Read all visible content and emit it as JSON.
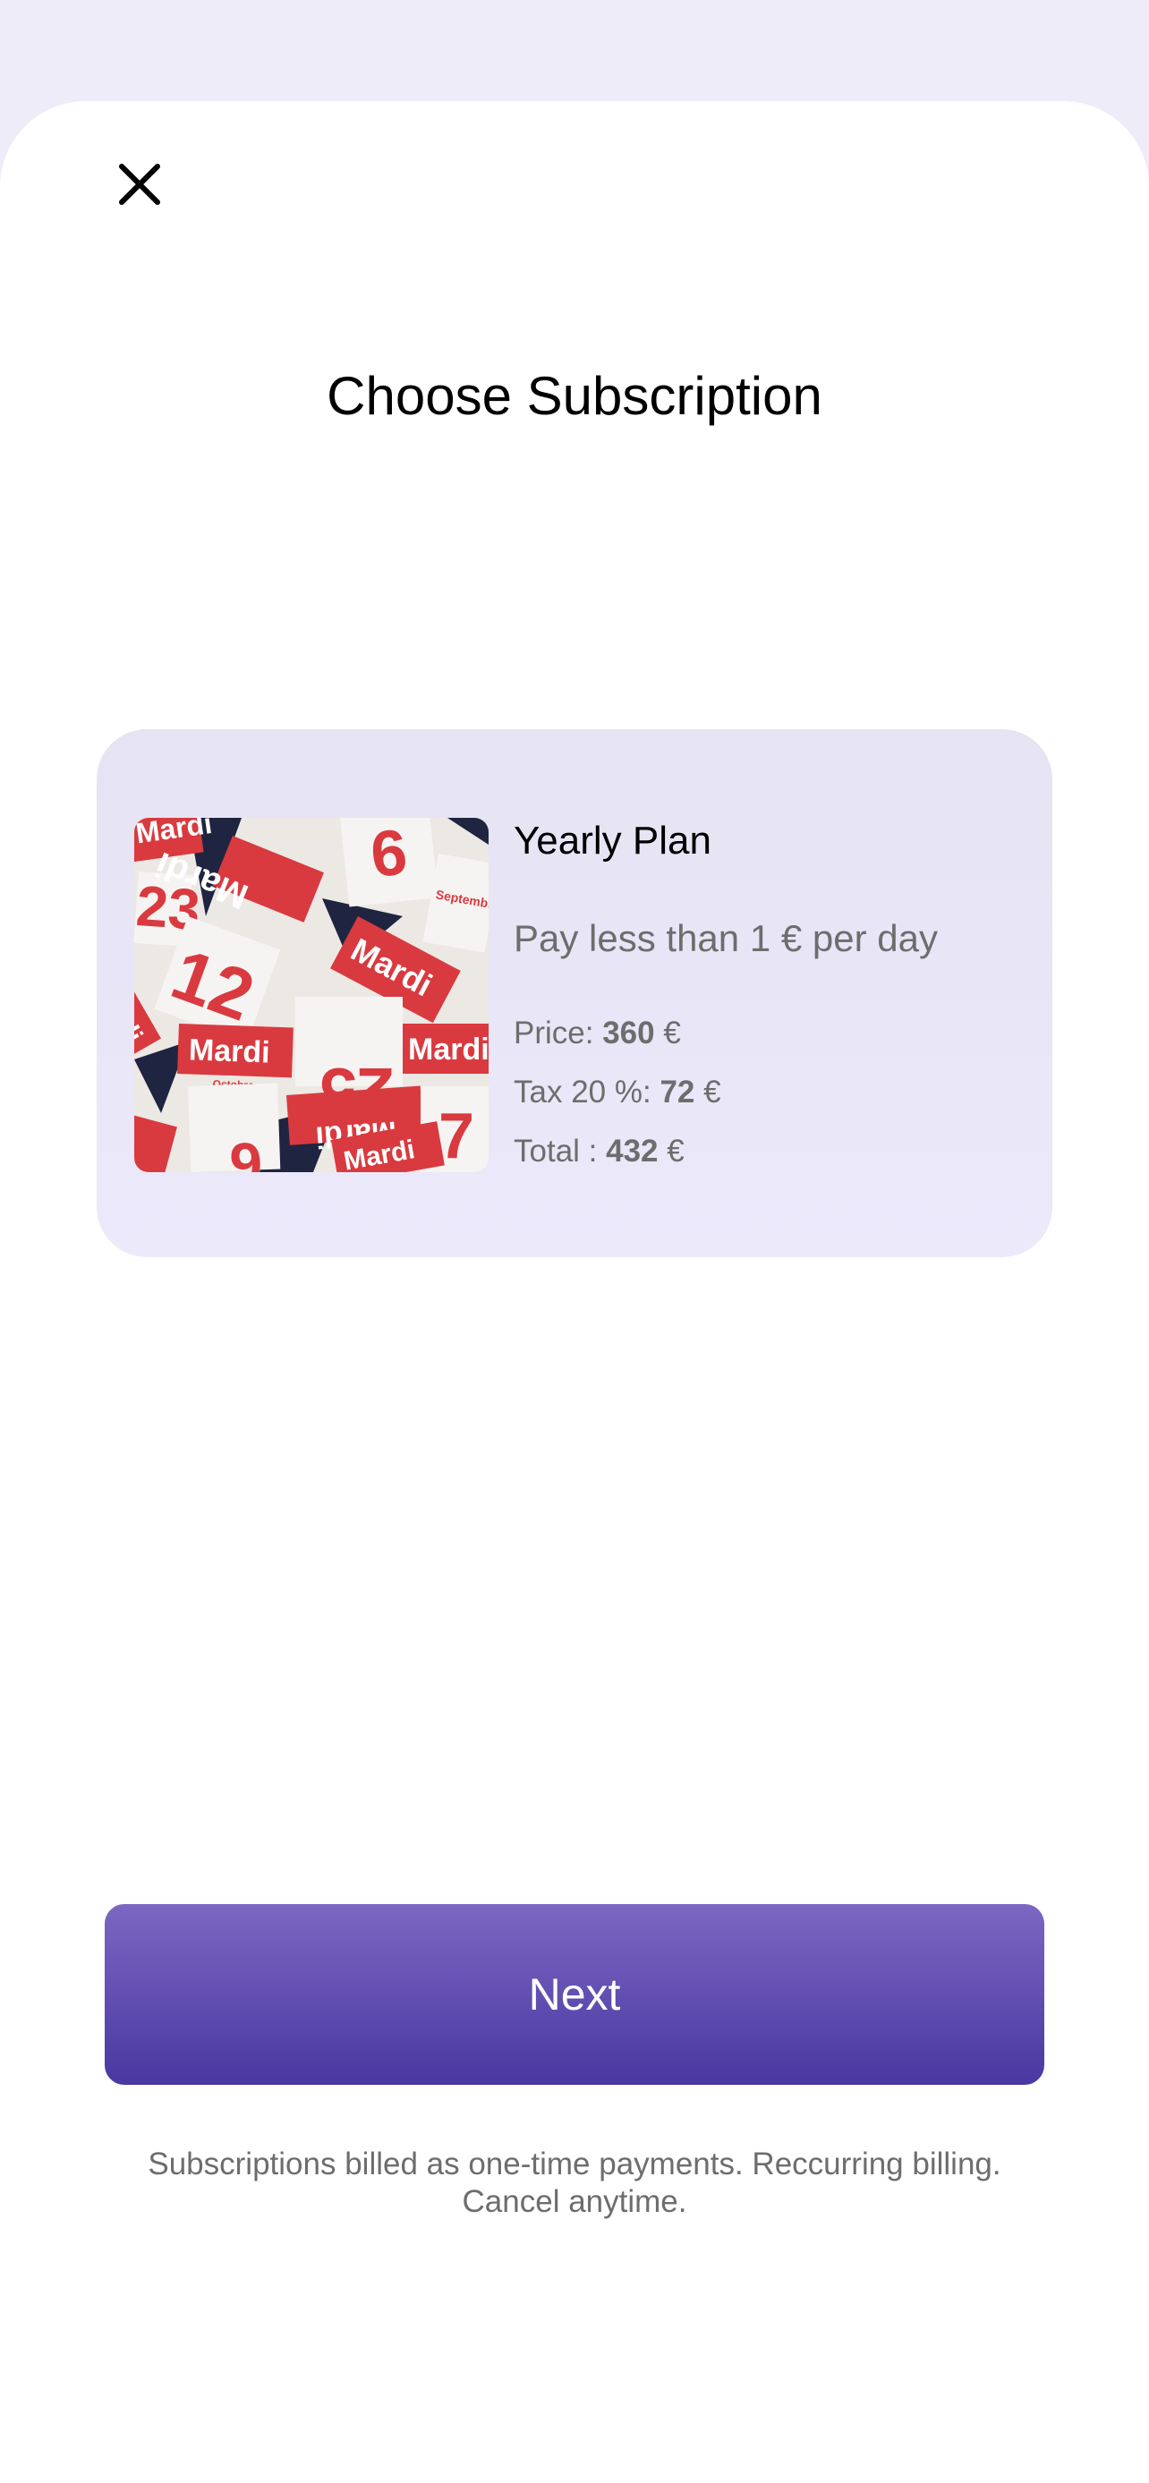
{
  "close_icon": "close-icon",
  "title": "Choose Subscription",
  "plan": {
    "name": "Yearly Plan",
    "tagline": "Pay less than 1 € per day",
    "image": "calendar-pages-photo",
    "price_label": "Price:",
    "price_value": "360",
    "tax_label": "Tax 20 %:",
    "tax_value": "72",
    "total_label": "Total :",
    "total_value": "432",
    "currency": "€",
    "image_text": [
      "Mardi",
      "Mardi",
      "Mardi",
      "Mardi",
      "Mardi",
      "Mardi",
      "12",
      "25",
      "9",
      "23",
      "6",
      "7",
      "Novembre",
      "Septembre",
      "Octobre"
    ]
  },
  "next_button": "Next",
  "footnote": "Subscriptions billed as one-time payments. Reccurring billing. Cancel anytime.",
  "colors": {
    "background": "#eeecf8",
    "card_top": "#e6e3f3",
    "card_bottom": "#ebe9fa",
    "button_top": "#7b68c2",
    "button_bottom": "#4a37a1",
    "secondary_text": "#6d6d6d",
    "calendar_red": "#d93a3f"
  }
}
